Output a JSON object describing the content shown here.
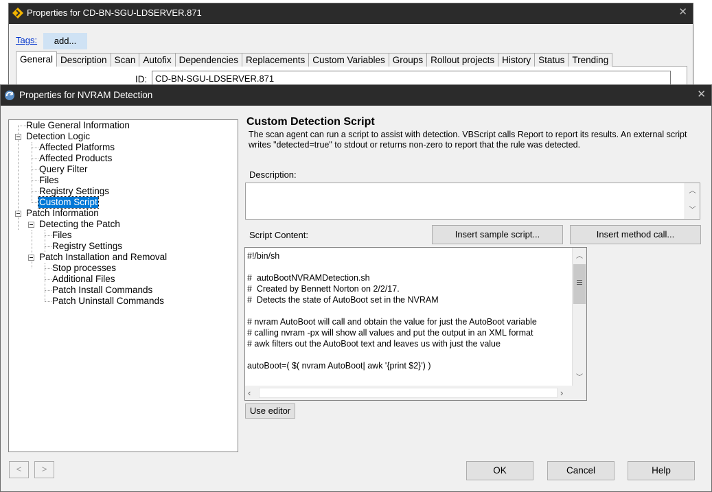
{
  "background_window": {
    "title": "Properties for CD-BN-SGU-LDSERVER.871",
    "tags_link": "Tags:",
    "tags_add": "add...",
    "tabs": [
      {
        "label": "General",
        "selected": true
      },
      {
        "label": "Description"
      },
      {
        "label": "Scan"
      },
      {
        "label": "Autofix"
      },
      {
        "label": "Dependencies"
      },
      {
        "label": "Replacements"
      },
      {
        "label": "Custom Variables"
      },
      {
        "label": "Groups"
      },
      {
        "label": "Rollout projects"
      },
      {
        "label": "History"
      },
      {
        "label": "Status"
      },
      {
        "label": "Trending"
      }
    ],
    "id_label": "ID:",
    "id_value": "CD-BN-SGU-LDSERVER.871",
    "close_icon": "close-icon"
  },
  "window": {
    "title": "Properties for NVRAM Detection",
    "close_icon": "close-icon"
  },
  "tree": {
    "rule_general": "Rule General Information",
    "detection_logic": "Detection Logic",
    "affected_platforms": "Affected Platforms",
    "affected_products": "Affected Products",
    "query_filter": "Query Filter",
    "files": "Files",
    "registry_settings": "Registry Settings",
    "custom_script": "Custom Script",
    "patch_information": "Patch Information",
    "detecting_the_patch": "Detecting the Patch",
    "detecting_files": "Files",
    "detecting_registry": "Registry Settings",
    "patch_install_removal": "Patch Installation and Removal",
    "stop_processes": "Stop processes",
    "additional_files": "Additional Files",
    "patch_install_commands": "Patch Install Commands",
    "patch_uninstall_commands": "Patch Uninstall Commands",
    "selected": "Custom Script"
  },
  "nav": {
    "back": "<",
    "forward": ">"
  },
  "panel": {
    "heading": "Custom Detection Script",
    "description": "The scan agent can run a script to assist with detection. VBScript calls Report to report its results.  An external script writes \"detected=true\" to stdout or returns non-zero to report that the rule was detected.",
    "description_label": "Description:",
    "description_value": "",
    "script_label": "Script Content:",
    "insert_sample_button": "Insert sample script...",
    "insert_method_button": "Insert method call...",
    "script_content": "#!/bin/sh\n\n#  autoBootNVRAMDetection.sh\n#  Created by Bennett Norton on 2/2/17.\n#  Detects the state of AutoBoot set in the NVRAM\n\n# nvram AutoBoot will call and obtain the value for just the AutoBoot variable\n# calling nvram -px will show all values and put the output in an XML format\n# awk filters out the AutoBoot text and leaves us with just the value\n\nautoBoot=( $( nvram AutoBoot| awk '{print $2}') )",
    "use_editor_button": "Use editor"
  },
  "footer": {
    "ok_button": "OK",
    "cancel_button": "Cancel",
    "help_button": "Help"
  },
  "colors": {
    "titlebar": "#2b2b2b",
    "selection": "#0078d7",
    "link": "#0033cc",
    "window_bg": "#f0f0f0"
  }
}
